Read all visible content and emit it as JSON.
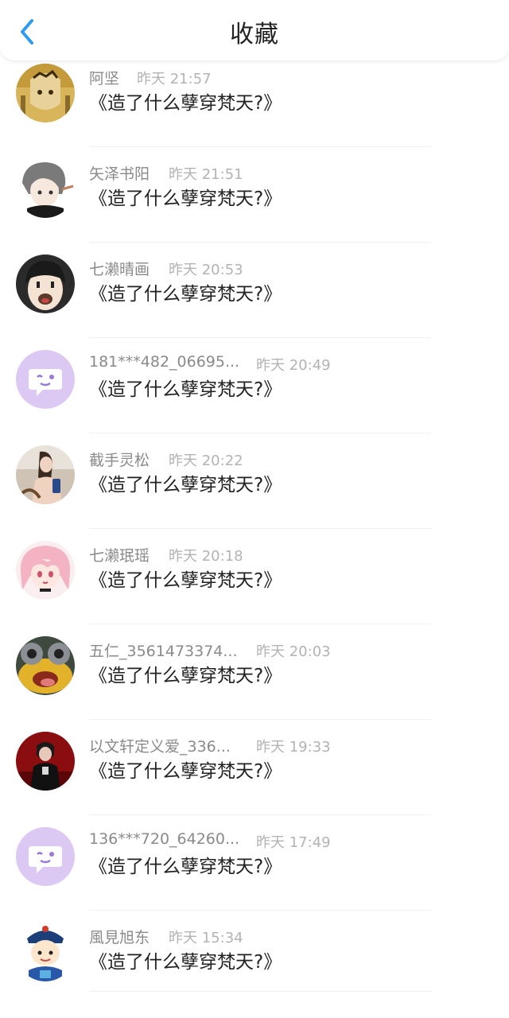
{
  "header": {
    "title": "收藏",
    "back_icon": "chevron-left-icon",
    "accent_color": "#2f9bf0"
  },
  "favorites": [
    {
      "name": "阿坚",
      "time": "昨天 21:57",
      "content": "《造了什么孽穿梵天?》",
      "avatar": "anime-character-avatar"
    },
    {
      "name": "矢泽书阳",
      "time": "昨天 21:51",
      "content": "《造了什么孽穿梵天?》",
      "avatar": "anime-character-avatar"
    },
    {
      "name": "七濑晴画",
      "time": "昨天 20:53",
      "content": "《造了什么孽穿梵天?》",
      "avatar": "cartoon-face-avatar"
    },
    {
      "name": "181***482_06695...",
      "time": "昨天 20:49",
      "content": "《造了什么孽穿梵天?》",
      "avatar": "default-chat-bubble-avatar"
    },
    {
      "name": "截手灵松",
      "time": "昨天 20:22",
      "content": "《造了什么孽穿梵天?》",
      "avatar": "photo-avatar"
    },
    {
      "name": "七濑珉瑶",
      "time": "昨天 20:18",
      "content": "《造了什么孽穿梵天?》",
      "avatar": "pink-hair-anime-avatar"
    },
    {
      "name": "五仁_3561473374...",
      "time": "昨天 20:03",
      "content": "《造了什么孽穿梵天?》",
      "avatar": "cartoon-fish-avatar"
    },
    {
      "name": "以文轩定义爱_336...",
      "time": "昨天 19:33",
      "content": "《造了什么孽穿梵天?》",
      "avatar": "photo-avatar"
    },
    {
      "name": "136***720_64260...",
      "time": "昨天 17:49",
      "content": "《造了什么孽穿梵天?》",
      "avatar": "default-chat-bubble-avatar"
    },
    {
      "name": "風見旭东",
      "time": "昨天 15:34",
      "content": "《造了什么孽穿梵天?》",
      "avatar": "cartoon-qing-official-avatar"
    }
  ]
}
